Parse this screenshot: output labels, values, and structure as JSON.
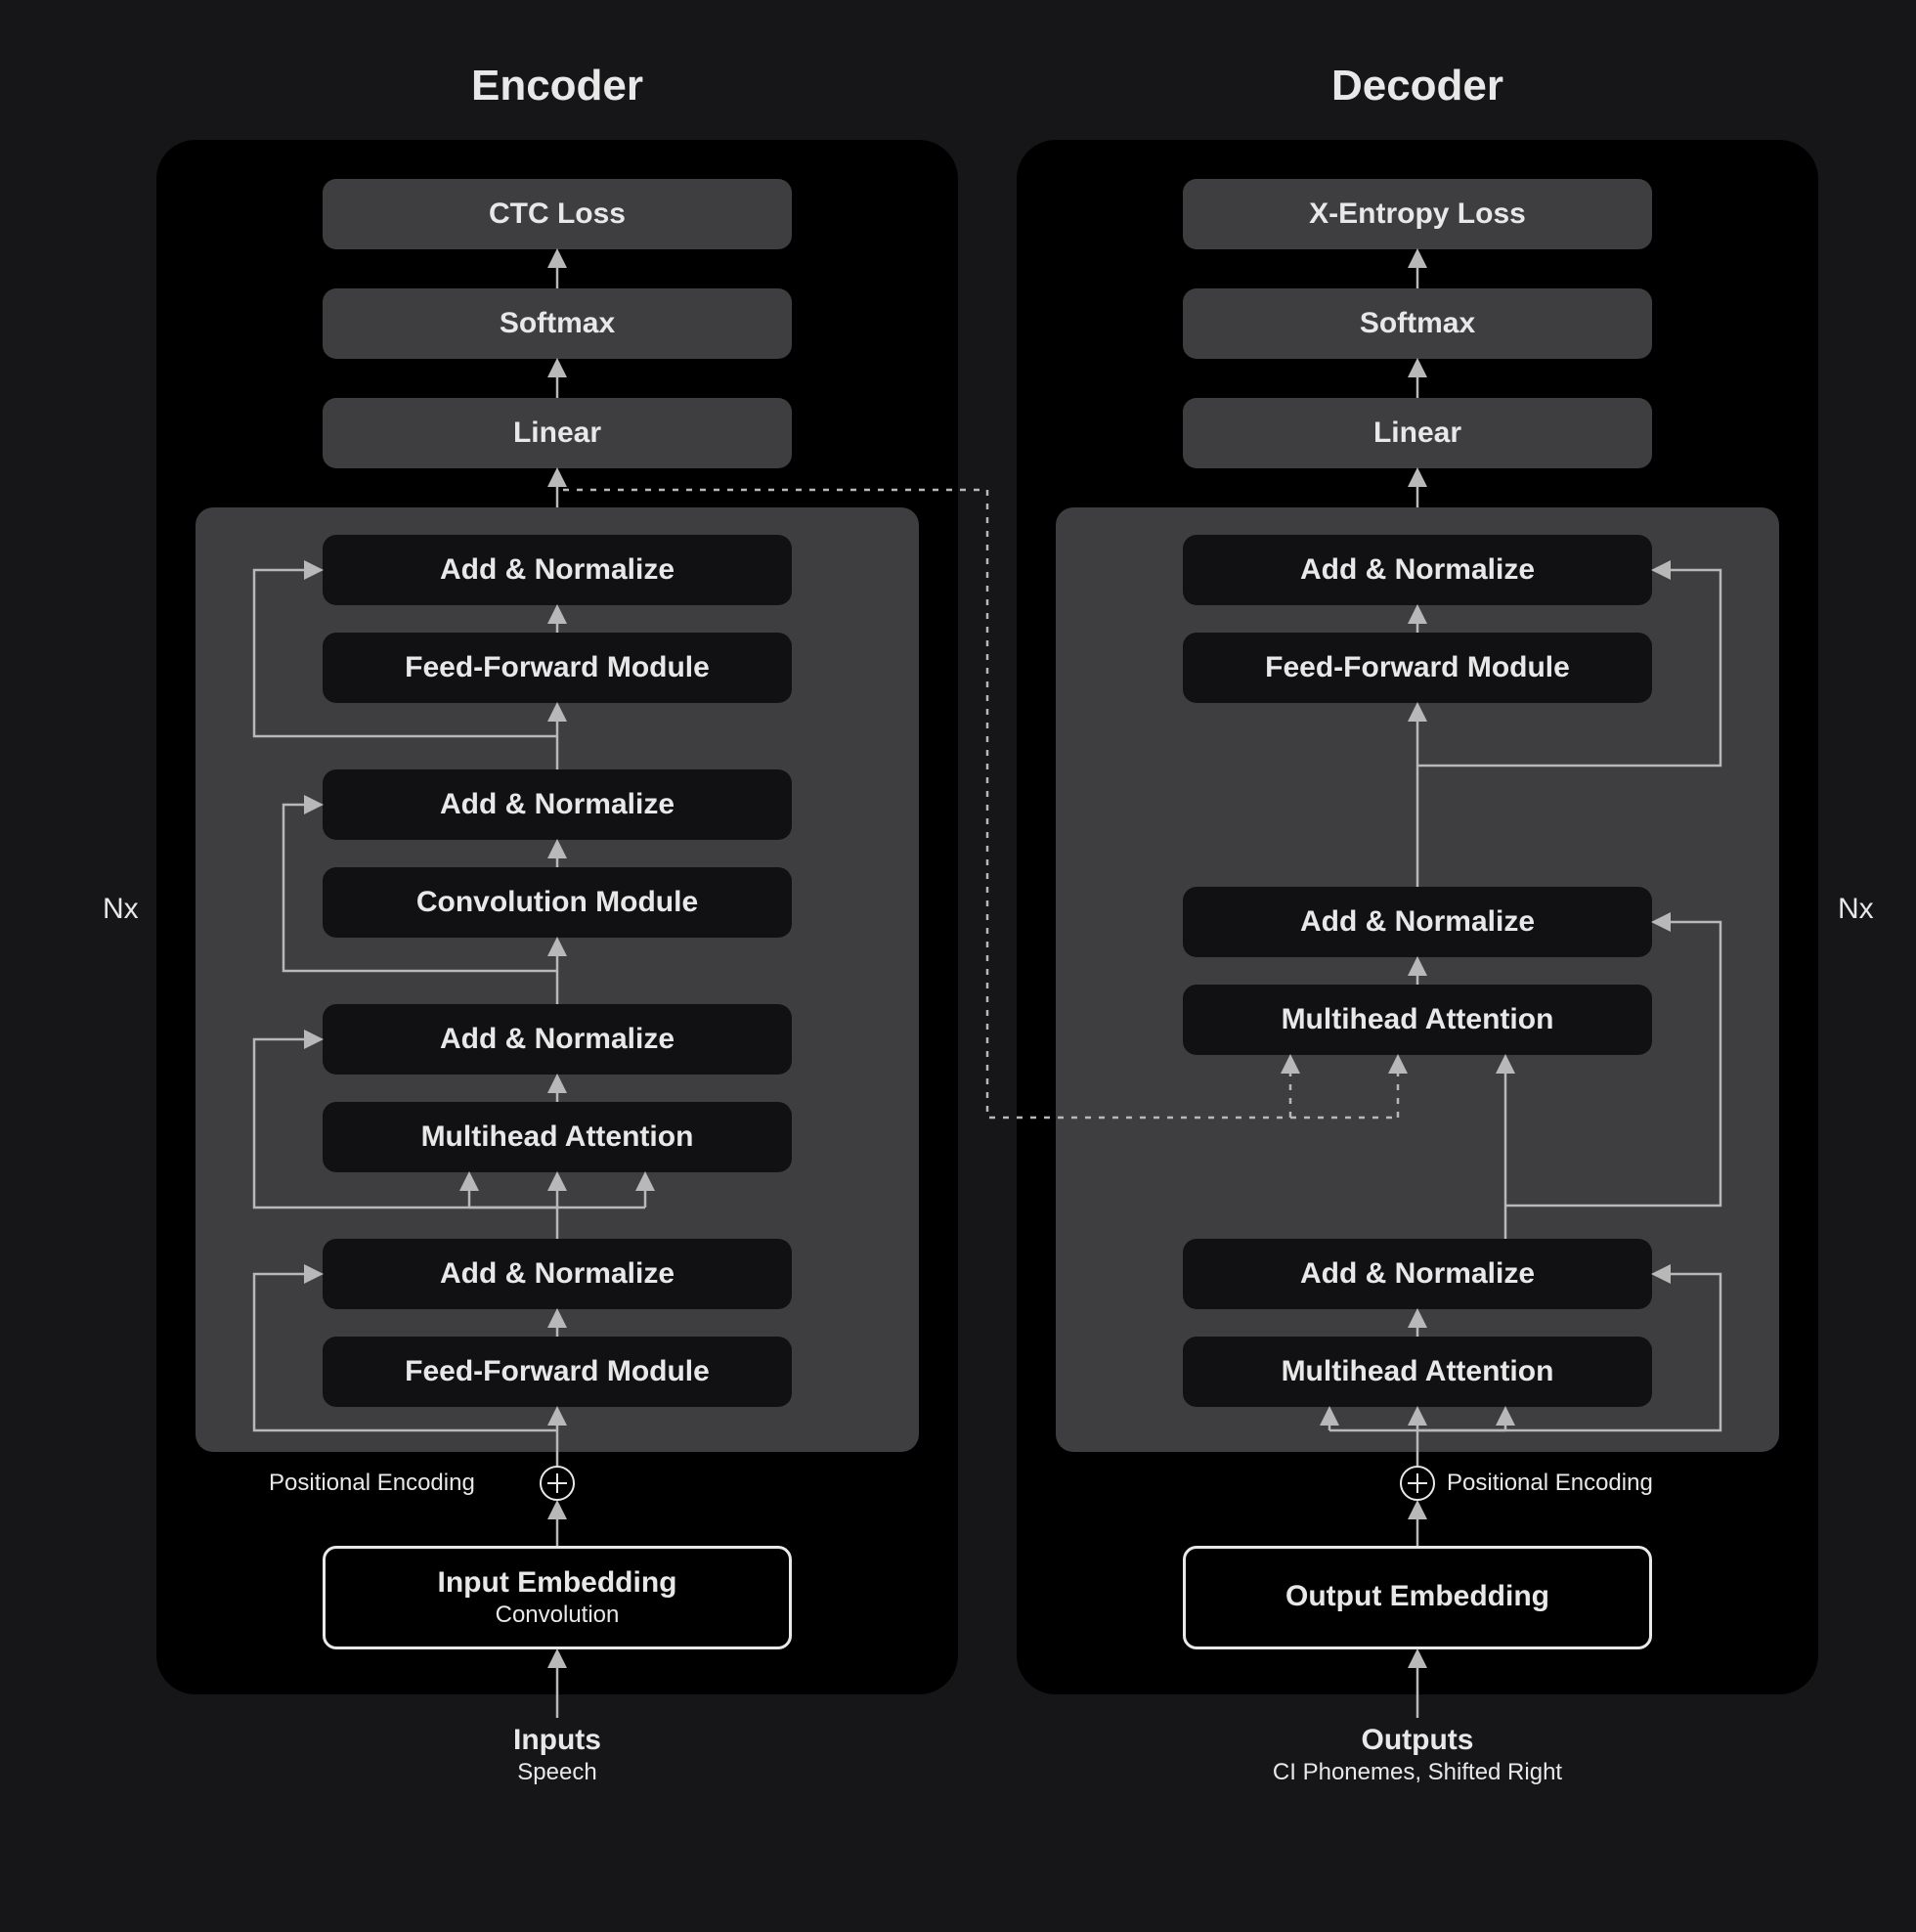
{
  "titles": {
    "encoder": "Encoder",
    "decoder": "Decoder"
  },
  "repeat_label": "Nx",
  "encoder": {
    "top3": [
      "CTC Loss",
      "Softmax",
      "Linear"
    ],
    "stack": [
      "Add & Normalize",
      "Feed-Forward Module",
      "Add & Normalize",
      "Convolution Module",
      "Add & Normalize",
      "Multihead Attention",
      "Add & Normalize",
      "Feed-Forward Module"
    ],
    "pe": "Positional Encoding",
    "embedding": {
      "title": "Input Embedding",
      "sub": "Convolution"
    },
    "input": {
      "title": "Inputs",
      "sub": "Speech"
    }
  },
  "decoder": {
    "top3": [
      "X-Entropy Loss",
      "Softmax",
      "Linear"
    ],
    "stack": [
      "Add & Normalize",
      "Feed-Forward Module",
      "Add & Normalize",
      "Multihead Attention",
      "Add & Normalize",
      "Multihead Attention"
    ],
    "pe": "Positional Encoding",
    "embedding": {
      "title": "Output Embedding",
      "sub": ""
    },
    "output": {
      "title": "Outputs",
      "sub": "CI Phonemes, Shifted Right"
    }
  }
}
